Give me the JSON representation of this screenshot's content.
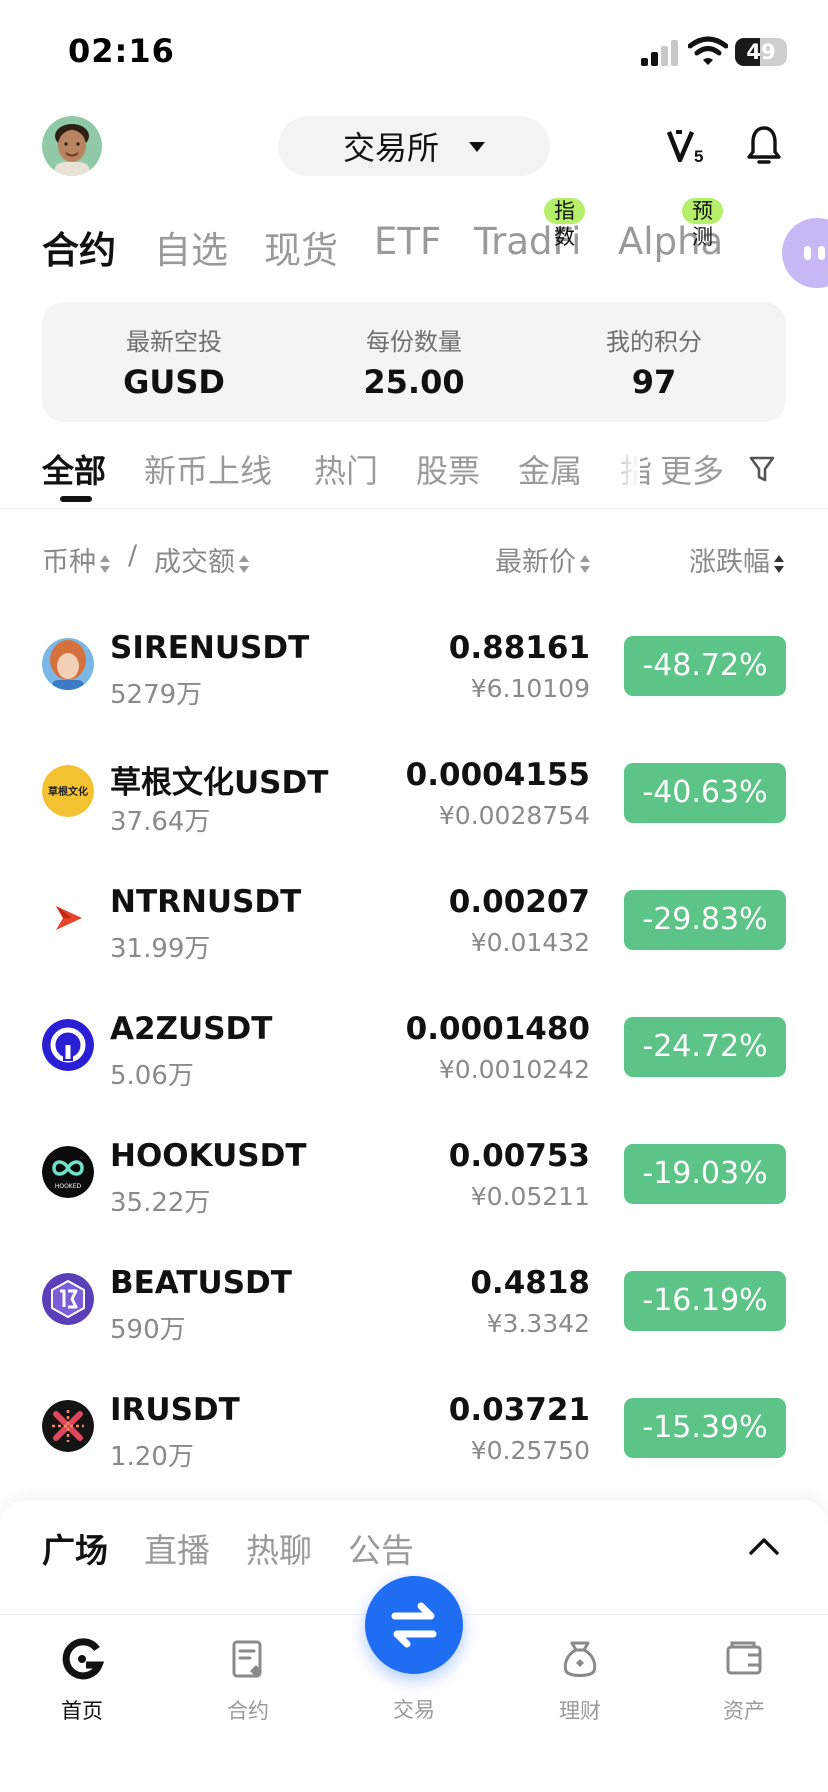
{
  "status_bar": {
    "time": "02:16",
    "battery": "49",
    "battery_level": 0.49
  },
  "header": {
    "exchange_label": "交易所"
  },
  "market_tabs": [
    {
      "label": "合约",
      "active": true,
      "badge": ""
    },
    {
      "label": "自选",
      "active": false,
      "badge": ""
    },
    {
      "label": "现货",
      "active": false,
      "badge": ""
    },
    {
      "label": "ETF",
      "active": false,
      "badge": ""
    },
    {
      "label": "TradFi",
      "active": false,
      "badge": "指数"
    },
    {
      "label": "Alpha",
      "active": false,
      "badge": "预测"
    }
  ],
  "points_card": {
    "airdrop_label": "最新空投",
    "airdrop_value": "GUSD",
    "quantity_label": "每份数量",
    "quantity_value": "25.00",
    "points_label": "我的积分",
    "points_value": "97"
  },
  "category_tabs": [
    {
      "label": "全部",
      "active": true
    },
    {
      "label": "新币上线",
      "active": false
    },
    {
      "label": "热门",
      "active": false
    },
    {
      "label": "股票",
      "active": false
    },
    {
      "label": "金属",
      "active": false
    },
    {
      "label": "指",
      "active": false
    }
  ],
  "more_label": "更多",
  "list_header": {
    "coin": "币种",
    "separator": "/",
    "volume": "成交额",
    "price": "最新价",
    "change": "涨跌幅"
  },
  "rows": [
    {
      "name": "SIRENUSDT",
      "volume": "5279万",
      "price": "0.88161",
      "cny": "¥6.10109",
      "change": "-48.72%"
    },
    {
      "name": "草根文化USDT",
      "volume": "37.64万",
      "price": "0.0004155",
      "cny": "¥0.0028754",
      "change": "-40.63%"
    },
    {
      "name": "NTRNUSDT",
      "volume": "31.99万",
      "price": "0.00207",
      "cny": "¥0.01432",
      "change": "-29.83%"
    },
    {
      "name": "A2ZUSDT",
      "volume": "5.06万",
      "price": "0.0001480",
      "cny": "¥0.0010242",
      "change": "-24.72%"
    },
    {
      "name": "HOOKUSDT",
      "volume": "35.22万",
      "price": "0.00753",
      "cny": "¥0.05211",
      "change": "-19.03%"
    },
    {
      "name": "BEATUSDT",
      "volume": "590万",
      "price": "0.4818",
      "cny": "¥3.3342",
      "change": "-16.19%"
    },
    {
      "name": "IRUSDT",
      "volume": "1.20万",
      "price": "0.03721",
      "cny": "¥0.25750",
      "change": "-15.39%"
    }
  ],
  "coin_icon_text": {
    "caogen": "草根文化",
    "hooked": "HOOKED"
  },
  "square_tabs": [
    {
      "label": "广场",
      "active": true
    },
    {
      "label": "直播",
      "active": false
    },
    {
      "label": "热聊",
      "active": false
    },
    {
      "label": "公告",
      "active": false
    }
  ],
  "bottom_nav": {
    "home": "首页",
    "futures": "合约",
    "trade": "交易",
    "earn": "理财",
    "assets": "资产"
  },
  "colors": {
    "change_negative_bg": "#5cc486",
    "badge_green": "#b6f06a",
    "trade_button": "#1f6df2",
    "assistant_bubble": "#c8b7f5"
  },
  "icons": {
    "vip": "vip-5-icon",
    "bell": "bell-icon",
    "filter": "filter-icon",
    "chevron": "chevron-up-icon",
    "trade": "swap-arrows-icon"
  }
}
